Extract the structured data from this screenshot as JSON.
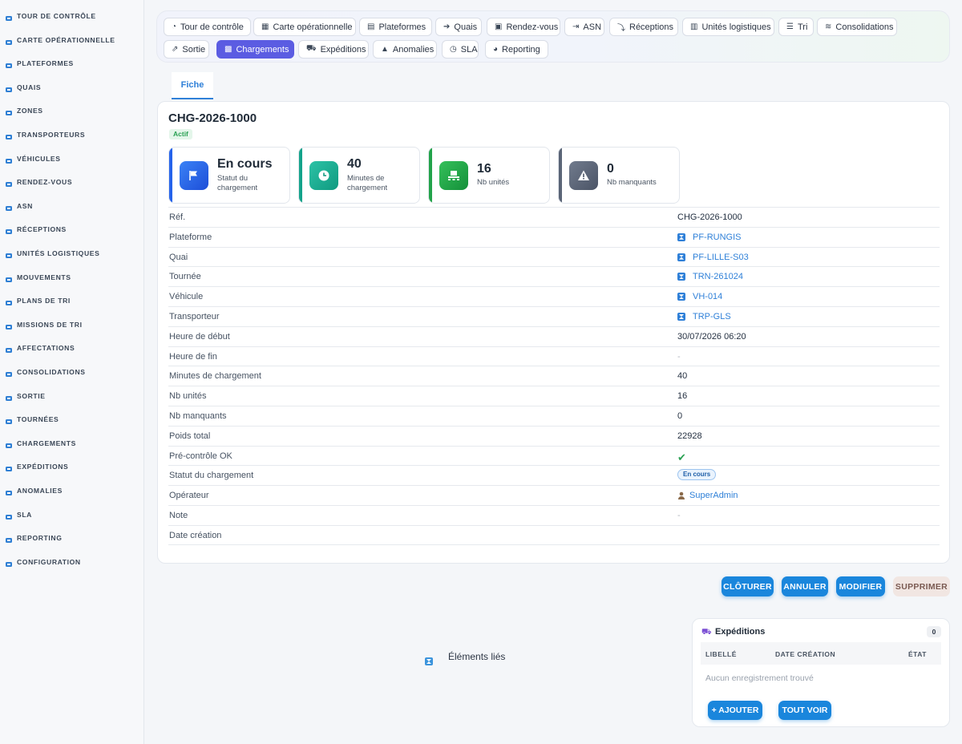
{
  "sidebar": {
    "items": [
      {
        "label": "TOUR DE CONTRÔLE",
        "icon": "gauge-icon"
      },
      {
        "label": "CARTE OPÉRATIONNELLE",
        "icon": "map-icon"
      },
      {
        "label": "PLATEFORMES",
        "icon": "warehouse-icon"
      },
      {
        "label": "QUAIS",
        "icon": "door-enter-icon"
      },
      {
        "label": "ZONES",
        "icon": "grid-icon"
      },
      {
        "label": "TRANSPORTEURS",
        "icon": "truck-icon"
      },
      {
        "label": "VÉHICULES",
        "icon": "van-icon"
      },
      {
        "label": "RENDEZ-VOUS",
        "icon": "calendar-icon"
      },
      {
        "label": "ASN",
        "icon": "file-import-icon"
      },
      {
        "label": "RÉCEPTIONS",
        "icon": "dolly-icon"
      },
      {
        "label": "UNITÉS LOGISTIQUES",
        "icon": "pallet-icon"
      },
      {
        "label": "MOUVEMENTS",
        "icon": "arrows-exchange-icon"
      },
      {
        "label": "PLANS DE TRI",
        "icon": "sitemap-icon"
      },
      {
        "label": "MISSIONS DE TRI",
        "icon": "list-icon"
      },
      {
        "label": "AFFECTATIONS",
        "icon": "shuffle-icon"
      },
      {
        "label": "CONSOLIDATIONS",
        "icon": "layers-icon"
      },
      {
        "label": "SORTIE",
        "icon": "exit-icon"
      },
      {
        "label": "TOURNÉES",
        "icon": "route-icon"
      },
      {
        "label": "CHARGEMENTS",
        "icon": "loading-icon"
      },
      {
        "label": "EXPÉDITIONS",
        "icon": "shipping-icon"
      },
      {
        "label": "ANOMALIES",
        "icon": "warning-icon"
      },
      {
        "label": "SLA",
        "icon": "stopwatch-icon"
      },
      {
        "label": "REPORTING",
        "icon": "pie-chart-icon"
      },
      {
        "label": "CONFIGURATION",
        "icon": "gear-icon"
      }
    ]
  },
  "topbar": {
    "tabs": [
      {
        "label": "Tour de contrôle",
        "icon": "◔"
      },
      {
        "label": "Carte opérationnelle",
        "icon": "▦"
      },
      {
        "label": "Plateformes",
        "icon": "▤"
      },
      {
        "label": "Quais",
        "icon": "➔"
      },
      {
        "label": "Rendez-vous",
        "icon": "▣"
      },
      {
        "label": "ASN",
        "icon": "⇥"
      },
      {
        "label": "Réceptions",
        "icon": "⤵"
      },
      {
        "label": "Unités logistiques",
        "icon": "▥"
      },
      {
        "label": "Tri",
        "icon": "☰"
      },
      {
        "label": "Consolidations",
        "icon": "≋"
      },
      {
        "label": "Sortie",
        "icon": "⇗"
      },
      {
        "label": "Chargements",
        "icon": "▩"
      },
      {
        "label": "Expéditions",
        "icon": "⛟"
      },
      {
        "label": "Anomalies",
        "icon": "▲"
      },
      {
        "label": "SLA",
        "icon": "◷"
      },
      {
        "label": "Reporting",
        "icon": "◕"
      }
    ]
  },
  "detail_tab": "Fiche",
  "record": {
    "title": "CHG-2026-1000",
    "status_badge": "Actif",
    "kpis": [
      {
        "value": "En cours",
        "label_line1": "Statut du",
        "label_line2": "chargement",
        "color": "#2563eb"
      },
      {
        "value": "40",
        "label_line1": "Minutes de",
        "label_line2": "chargement",
        "color": "#14a38b"
      },
      {
        "value": "16",
        "label_line1": "Nb unités",
        "label_line2": "",
        "color": "#22a34a"
      },
      {
        "value": "0",
        "label_line1": "Nb manquants",
        "label_line2": "",
        "color": "#5b6577"
      }
    ],
    "fields": [
      {
        "label": "Réf.",
        "value": "CHG-2026-1000",
        "kind": "text"
      },
      {
        "label": "Plateforme",
        "value": "PF-RUNGIS",
        "kind": "link"
      },
      {
        "label": "Quai",
        "value": "PF-LILLE-S03",
        "kind": "link"
      },
      {
        "label": "Tournée",
        "value": "TRN-261024",
        "kind": "link"
      },
      {
        "label": "Véhicule",
        "value": "VH-014",
        "kind": "link"
      },
      {
        "label": "Transporteur",
        "value": "TRP-GLS",
        "kind": "link"
      },
      {
        "label": "Heure de début",
        "value": "30/07/2026 06:20",
        "kind": "text"
      },
      {
        "label": "Heure de fin",
        "value": "-",
        "kind": "muted"
      },
      {
        "label": "Minutes de chargement",
        "value": "40",
        "kind": "text"
      },
      {
        "label": "Nb unités",
        "value": "16",
        "kind": "text"
      },
      {
        "label": "Nb manquants",
        "value": "0",
        "kind": "text"
      },
      {
        "label": "Poids total",
        "value": "22928",
        "kind": "text"
      },
      {
        "label": "Pré-contrôle OK",
        "value": "✔",
        "kind": "check"
      },
      {
        "label": "Statut du chargement",
        "value": "En cours",
        "kind": "pill"
      },
      {
        "label": "Opérateur",
        "value": "SuperAdmin",
        "kind": "user"
      },
      {
        "label": "Note",
        "value": "-",
        "kind": "muted"
      },
      {
        "label": "Date création",
        "value": "",
        "kind": "text"
      }
    ]
  },
  "actions": {
    "close": "CLÔTURER",
    "cancel": "ANNULER",
    "edit": "MODIFIER",
    "delete": "SUPPRIMER"
  },
  "linked": {
    "title": "Éléments liés"
  },
  "expeditions": {
    "title": "Expéditions",
    "count": "0",
    "columns": [
      "LIBELLÉ",
      "DATE CRÉATION",
      "ÉTAT"
    ],
    "empty": "Aucun enregistrement trouvé",
    "add_label": "+ AJOUTER",
    "view_all_label": "TOUT VOIR"
  },
  "colors": {
    "accent": "#1a86dc",
    "active_tab": "#5b5ce2",
    "link": "#2f80d8"
  }
}
